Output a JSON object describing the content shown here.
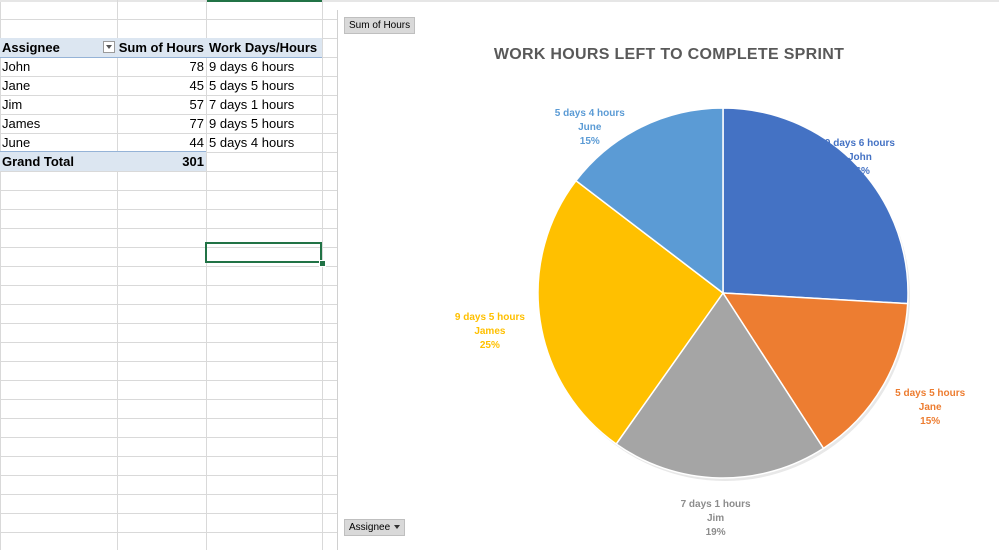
{
  "pivot": {
    "headers": {
      "assignee": "Assignee",
      "sum": "Sum of Hours",
      "workdays": "Work Days/Hours"
    },
    "rows": [
      {
        "assignee": "John",
        "hours": "78",
        "workdays": "9 days 6 hours"
      },
      {
        "assignee": "Jane",
        "hours": "45",
        "workdays": "5 days 5 hours"
      },
      {
        "assignee": "Jim",
        "hours": "57",
        "workdays": "7 days 1 hours"
      },
      {
        "assignee": "James",
        "hours": "77",
        "workdays": "9 days 5 hours"
      },
      {
        "assignee": "June",
        "hours": "44",
        "workdays": "5 days 4 hours"
      }
    ],
    "total": {
      "label": "Grand Total",
      "value": "301"
    }
  },
  "chart": {
    "value_field_button": "Sum of Hours",
    "axis_field_button": "Assignee"
  },
  "chart_data": {
    "type": "pie",
    "title": "WORK HOURS LEFT TO COMPLETE SPRINT",
    "categories": [
      "John",
      "Jane",
      "Jim",
      "James",
      "June"
    ],
    "values": [
      78,
      45,
      57,
      77,
      44
    ],
    "label_lines": [
      "9 days 6 hours",
      "5 days 5 hours",
      "7 days 1 hours",
      "9 days 5 hours",
      "5 days 4 hours"
    ],
    "percent_labels": [
      "26%",
      "15%",
      "19%",
      "25%",
      "15%"
    ],
    "colors": [
      "#4472C4",
      "#ED7D31",
      "#A5A5A5",
      "#FFC000",
      "#5B9BD5"
    ],
    "label_colors": [
      "#4472C4",
      "#ED7D31",
      "#8C8C8C",
      "#FFC000",
      "#5B9BD5"
    ]
  }
}
